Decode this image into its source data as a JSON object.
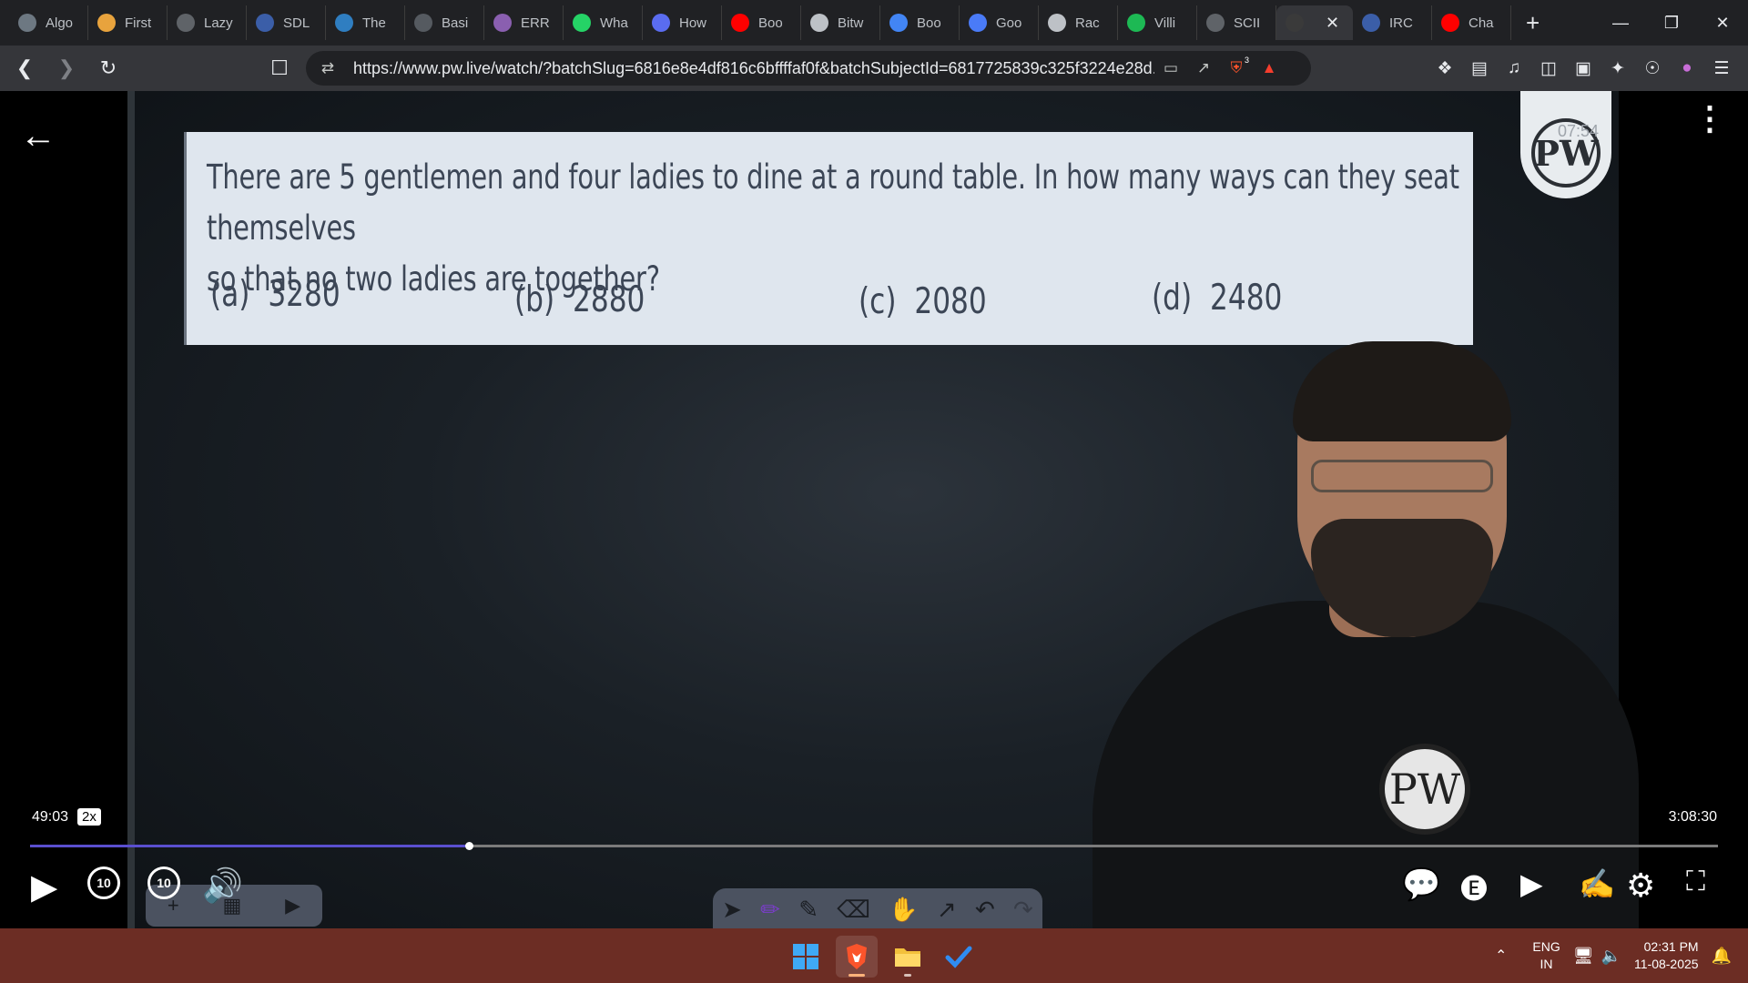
{
  "browser": {
    "tabs": [
      {
        "label": "Algo",
        "icon": "chatgpt-icon",
        "color": "#6d7882"
      },
      {
        "label": "First",
        "icon": "first-icon",
        "color": "#e8a33d"
      },
      {
        "label": "Lazy",
        "icon": "globe-icon",
        "color": "#5f6368"
      },
      {
        "label": "SDL",
        "icon": "sdl-icon",
        "color": "#3b5ea8"
      },
      {
        "label": "The",
        "icon": "w3-icon",
        "color": "#2f7ec1"
      },
      {
        "label": "Basi",
        "icon": "basic-icon",
        "color": "#555a60"
      },
      {
        "label": "ERR",
        "icon": "err-icon",
        "color": "#8a5fb0"
      },
      {
        "label": "Wha",
        "icon": "whatsapp-icon",
        "color": "#25d366"
      },
      {
        "label": "How",
        "icon": "bookmark-icon",
        "color": "#5a6cf0"
      },
      {
        "label": "Boo",
        "icon": "youtube-icon",
        "color": "#ff0000"
      },
      {
        "label": "Bitw",
        "icon": "bitwise-icon",
        "color": "#bdc1c6"
      },
      {
        "label": "Boo",
        "icon": "google-icon",
        "color": "#4285f4"
      },
      {
        "label": "Goo",
        "icon": "gemini-icon",
        "color": "#4a7bf7"
      },
      {
        "label": "Rac",
        "icon": "openai-icon",
        "color": "#bdc1c6"
      },
      {
        "label": "Villi",
        "icon": "spotify-icon",
        "color": "#1db954"
      },
      {
        "label": "SCII",
        "icon": "globe-icon",
        "color": "#5f6368"
      },
      {
        "label": "",
        "icon": "pw-tab-icon",
        "color": "#3a3a3a",
        "active": true
      },
      {
        "label": "IRC",
        "icon": "irctc-icon",
        "color": "#3b5ea8"
      },
      {
        "label": "Cha",
        "icon": "youtube-icon",
        "color": "#ff0000"
      }
    ],
    "url": "https://www.pw.live/watch/?batchSlug=6816e8e4df816c6bffffaf0f&batchSubjectId=6817725839c325f3224e28d...",
    "shield_count": "3"
  },
  "question": {
    "text_line1": "There are 5 gentlemen and four ladies to dine  at a round table. In how many ways can they seat themselves",
    "text_line2": "so that no two ladies are together?",
    "options": [
      {
        "label": "(a)",
        "value": "3280"
      },
      {
        "label": "(b)",
        "value": "2880"
      },
      {
        "label": "(c)",
        "value": "2080"
      },
      {
        "label": "(d)",
        "value": "2480"
      }
    ]
  },
  "logo": {
    "letters": "PW",
    "stamp": "07:54"
  },
  "player": {
    "current_time": "49:03",
    "speed": "2x",
    "total_time": "3:08:30",
    "progress_fraction": 0.26,
    "rewind_label": "10",
    "forward_label": "10",
    "accent": "#5a4fcf"
  },
  "taskbar": {
    "lang_line1": "ENG",
    "lang_line2": "IN",
    "time": "02:31 PM",
    "date": "11-08-2025",
    "bg": "#6c2d24"
  }
}
